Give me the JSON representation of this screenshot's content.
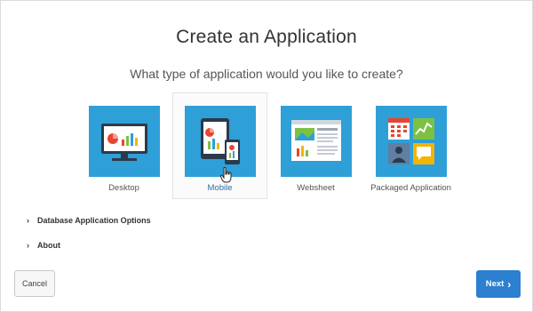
{
  "dialog": {
    "title": "Create an Application",
    "subtitle": "What type of application would you like to create?"
  },
  "app_types": [
    {
      "label": "Desktop",
      "icon": "desktop-monitor-icon",
      "selected": false
    },
    {
      "label": "Mobile",
      "icon": "mobile-devices-icon",
      "selected": true
    },
    {
      "label": "Websheet",
      "icon": "websheet-icon",
      "selected": false
    },
    {
      "label": "Packaged Application",
      "icon": "packaged-application-icon",
      "selected": false
    }
  ],
  "sections": [
    {
      "label": "Database Application Options",
      "expanded": false
    },
    {
      "label": "About",
      "expanded": false
    }
  ],
  "buttons": {
    "cancel": "Cancel",
    "next": "Next"
  },
  "colors": {
    "tile_blue": "#2f9fd8",
    "primary_button": "#2d7fd0",
    "selected_label": "#2e6da4"
  }
}
